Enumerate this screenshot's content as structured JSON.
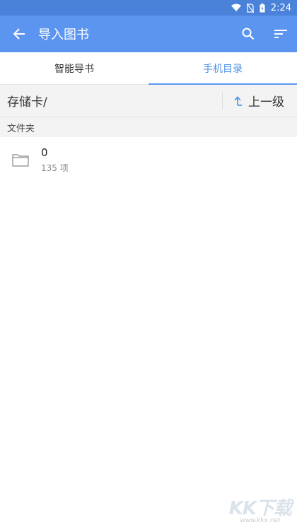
{
  "status_bar": {
    "time": "2:24"
  },
  "app_bar": {
    "title": "导入图书"
  },
  "tabs": [
    {
      "label": "智能导书",
      "active": false
    },
    {
      "label": "手机目录",
      "active": true
    }
  ],
  "path_bar": {
    "path": "存储卡/",
    "up_label": "上一级"
  },
  "section": {
    "title": "文件夹"
  },
  "items": [
    {
      "name": "0",
      "count": "135 项"
    }
  ],
  "watermark": {
    "logo": "KK下载",
    "url": "www.kkx.net"
  },
  "colors": {
    "status_bar": "#4a82da",
    "app_bar": "#5b95f0",
    "accent": "#4a90e2"
  }
}
